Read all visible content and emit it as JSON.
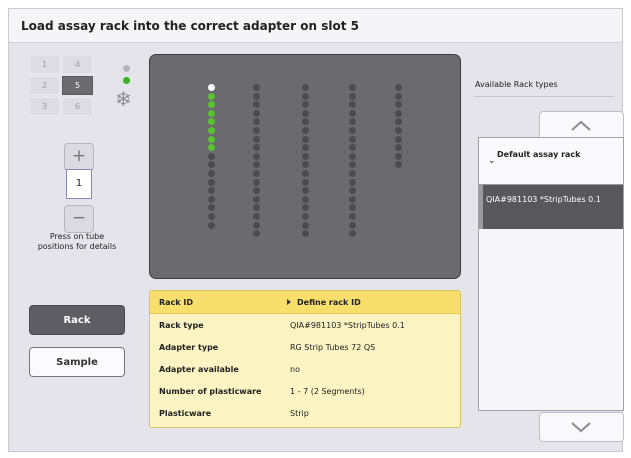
{
  "header": {
    "title": "Load assay rack into the correct adapter on slot 5"
  },
  "slots": [
    {
      "label": "1",
      "active": false
    },
    {
      "label": "4",
      "active": false
    },
    {
      "label": "2",
      "active": false
    },
    {
      "label": "5",
      "active": true
    },
    {
      "label": "3",
      "active": false
    },
    {
      "label": "6",
      "active": false
    }
  ],
  "icons": {
    "cooling": "snowflake-icon",
    "plus": "plus-icon",
    "minus": "minus-icon",
    "scroll_up": "chevron-up-icon",
    "scroll_down": "chevron-down-icon",
    "expand": "chevron-down-icon",
    "define": "triangle-right-icon"
  },
  "colors": {
    "status_green": "#3faf28",
    "tube_green": "#57c22d",
    "info_header": "#f8de6b",
    "info_bg": "#fcf4c2",
    "rack_panel": "#6b6b6f",
    "active_dark": "#5d5d63"
  },
  "stepper": {
    "plus_label": "+",
    "value": "1",
    "minus_label": "−"
  },
  "hint": "Press on tube positions for details",
  "buttons": {
    "rack": "Rack",
    "sample": "Sample"
  },
  "rack": {
    "columns": [
      {
        "count": 17,
        "states": [
          "white",
          "green",
          "green",
          "green",
          "green",
          "green",
          "green",
          "green"
        ]
      },
      {
        "count": 18,
        "states": []
      },
      {
        "count": 18,
        "states": []
      },
      {
        "count": 18,
        "states": []
      },
      {
        "count": 10,
        "states": []
      }
    ]
  },
  "info": {
    "rows": [
      {
        "label": "Rack ID",
        "value": "Define rack ID",
        "header": true
      },
      {
        "label": "Rack type",
        "value": "QIA#981103 *StripTubes 0.1"
      },
      {
        "label": "Adapter type",
        "value": "RG Strip Tubes 72 QS"
      },
      {
        "label": "Adapter available",
        "value": "no"
      },
      {
        "label": "Number of plasticware",
        "value": "1 - 7 (2 Segments)"
      },
      {
        "label": "Plasticware",
        "value": "Strip"
      }
    ]
  },
  "available": {
    "title": "Available Rack types",
    "group": "Default assay rack",
    "items": [
      "QIA#981103 *StripTubes 0.1"
    ]
  }
}
